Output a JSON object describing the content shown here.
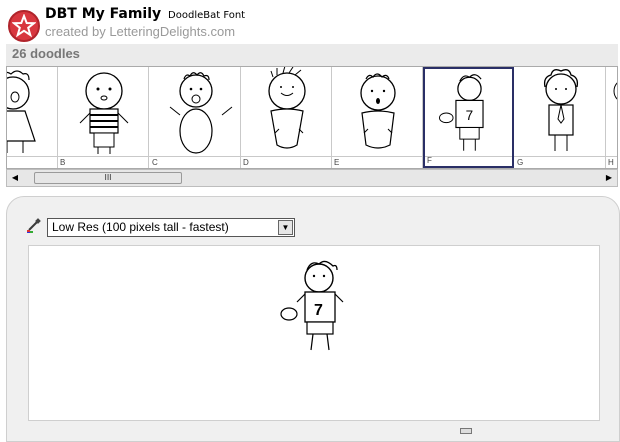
{
  "header": {
    "title": "DBT My Family",
    "subtitle": "DoodleBat Font",
    "author": "created by LetteringDelights.com",
    "count": "26 doodles"
  },
  "doodles": [
    {
      "letter": "",
      "icon": "toddler-crying-icon"
    },
    {
      "letter": "B",
      "icon": "boy-striped-shirt-icon"
    },
    {
      "letter": "C",
      "icon": "baby-curly-hair-icon"
    },
    {
      "letter": "D",
      "icon": "baby-spiky-hair-icon"
    },
    {
      "letter": "E",
      "icon": "baby-surprised-icon"
    },
    {
      "letter": "F",
      "icon": "football-player-icon",
      "selected": true
    },
    {
      "letter": "G",
      "icon": "curly-haired-man-icon"
    },
    {
      "letter": "H",
      "icon": "partial-doodle-icon"
    }
  ],
  "scrollbar": {
    "thumb_label": "III",
    "left_arrow": "◀",
    "right_arrow": "▶"
  },
  "resolution_select": {
    "value": "Low Res (100 pixels tall - fastest)"
  },
  "preview": {
    "icon": "football-player-icon"
  },
  "colors": {
    "logo": "#d8373f",
    "selection": "#2a2f66",
    "panel": "#f0f0f0"
  }
}
